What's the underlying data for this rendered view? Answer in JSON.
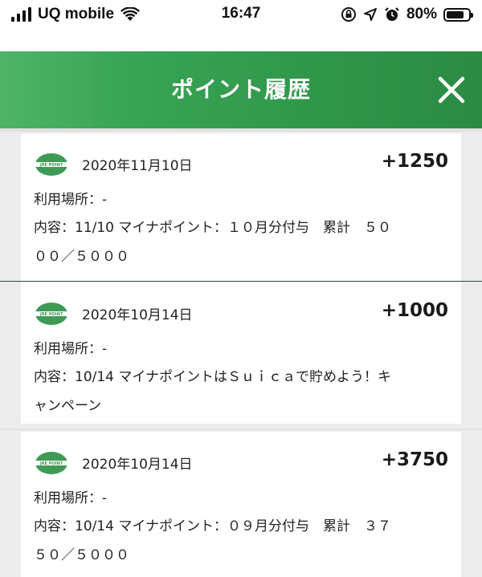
{
  "status_bar": {
    "carrier": "UQ mobile",
    "time": "16:47",
    "battery": "80%",
    "battery_level": 0.8
  },
  "header": {
    "title": "ポイント履歴",
    "close_icon": "close-icon",
    "color": "#339c4e"
  },
  "records": [
    {
      "date": "2020年11月10日",
      "points": "+1250",
      "place": "利用場所：-",
      "content_line1": "内容：11/10 マイナポイント：１０月分付与　累計　５０",
      "content_line2": "００／５０００"
    },
    {
      "date": "2020年10月14日",
      "points": "+1000",
      "place": "利用場所：-",
      "content_line1": "内容：10/14 マイナポイントはＳｕｉｃａで貯めよう！キ",
      "content_line2": "ャンペーン"
    },
    {
      "date": "2020年10月14日",
      "points": "+3750",
      "place": "利用場所：-",
      "content_line1": "内容：10/14 マイナポイント：０９月分付与　累計　３７",
      "content_line2": "５０／５０００"
    }
  ],
  "logo_label": "JRE POINT"
}
